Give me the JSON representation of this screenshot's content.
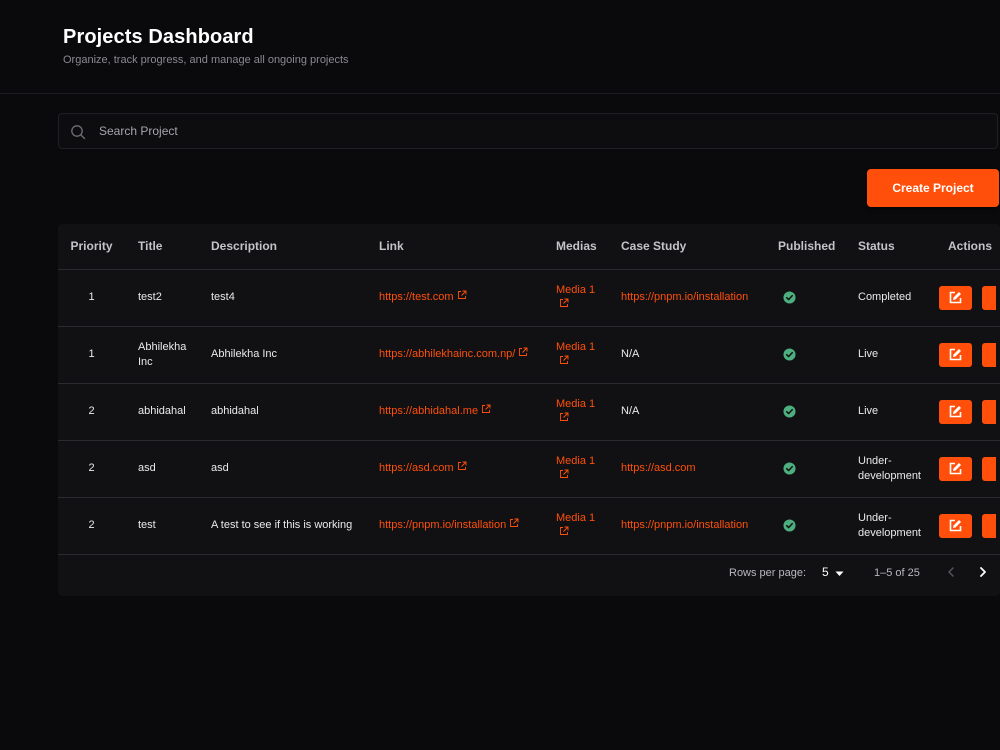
{
  "header": {
    "title": "Projects Dashboard",
    "subtitle": "Organize, track progress, and manage all ongoing projects"
  },
  "search": {
    "placeholder": "Search Project",
    "value": ""
  },
  "toolbar": {
    "create_label": "Create Project"
  },
  "table": {
    "columns": [
      "Priority",
      "Title",
      "Description",
      "Link",
      "Medias",
      "Case Study",
      "Published",
      "Status",
      "Actions"
    ],
    "rows": [
      {
        "priority": "1",
        "title": "test2",
        "description": "test4",
        "link": "https://test.com",
        "media": "Media 1",
        "case_study": "https://pnpm.io/installation",
        "case_is_link": true,
        "published": true,
        "status": "Completed"
      },
      {
        "priority": "1",
        "title": "Abhilekha Inc",
        "description": "Abhilekha Inc",
        "link": "https://abhilekhainc.com.np/",
        "media": "Media 1",
        "case_study": "N/A",
        "case_is_link": false,
        "published": true,
        "status": "Live"
      },
      {
        "priority": "2",
        "title": "abhidahal",
        "description": "abhidahal",
        "link": "https://abhidahal.me",
        "media": "Media 1",
        "case_study": "N/A",
        "case_is_link": false,
        "published": true,
        "status": "Live"
      },
      {
        "priority": "2",
        "title": "asd",
        "description": "asd",
        "link": "https://asd.com",
        "media": "Media 1",
        "case_study": "https://asd.com",
        "case_is_link": true,
        "published": true,
        "status": "Under-development"
      },
      {
        "priority": "2",
        "title": "test",
        "description": "A test to see if this is working",
        "link": "https://pnpm.io/installation",
        "media": "Media 1",
        "case_study": "https://pnpm.io/installation",
        "case_is_link": true,
        "published": true,
        "status": "Under-development"
      }
    ]
  },
  "pagination": {
    "rows_per_page_label": "Rows per page:",
    "rows_per_page": "5",
    "range": "1–5 of 25"
  },
  "icons": {
    "search": "search-icon",
    "external_link": "external-link-icon",
    "published": "check-circle-icon",
    "edit": "edit-icon",
    "prev": "chevron-left-icon",
    "next": "chevron-right-icon",
    "dropdown": "caret-down-icon"
  },
  "colors": {
    "accent": "#ff4f0a",
    "success": "#4caf7d",
    "background": "#0a0a0c",
    "card": "#111114"
  }
}
